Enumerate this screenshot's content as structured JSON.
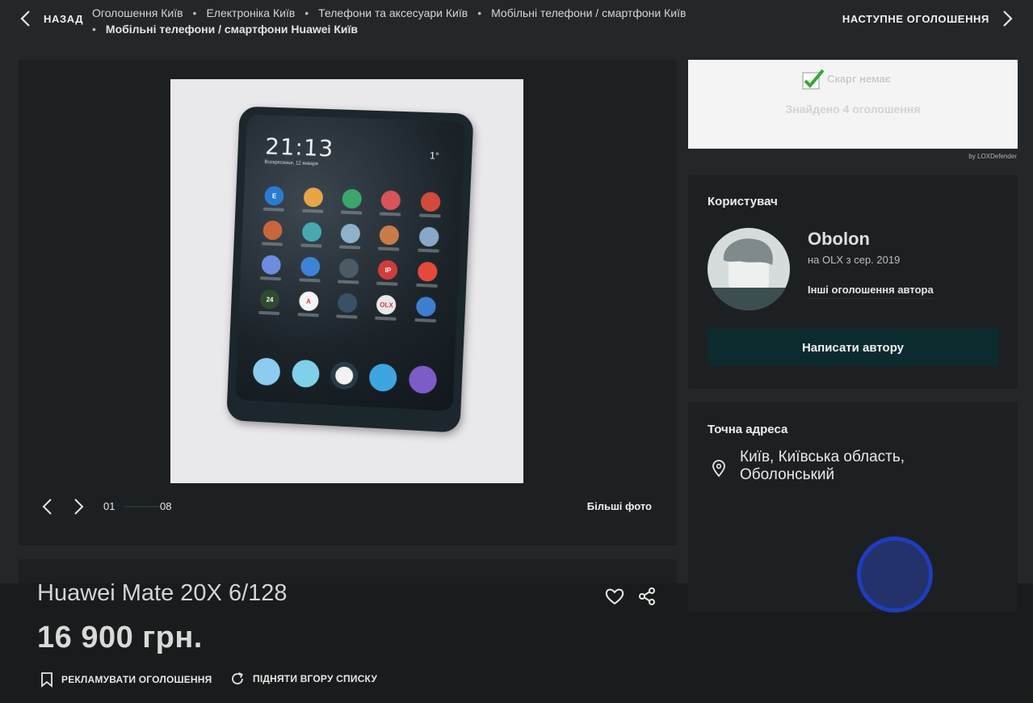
{
  "topbar": {
    "back_label": "НАЗАД",
    "next_label": "НАСТУПНЕ ОГОЛОШЕННЯ",
    "breadcrumbs": [
      "Оголошення Київ",
      "Електроніка Київ",
      "Телефони та аксесуари Київ",
      "Мобільні телефони / смартфони Київ",
      "Мобільні телефони / смартфони Huawei Київ"
    ]
  },
  "gallery": {
    "current_index": "01",
    "total": "08",
    "progress": 0.125,
    "more_photos_label": "Більші фото",
    "photo_text": {
      "clock": "21:13",
      "date": "Воскресенье, 12 января",
      "temp": "1°",
      "apps": [
        "E",
        "",
        "",
        "",
        "",
        "",
        "",
        "",
        "",
        "",
        "",
        "",
        "",
        "IP",
        "",
        "24",
        "А",
        "",
        "OLX",
        ""
      ]
    }
  },
  "listing": {
    "title": "Huawei Mate 20X 6/128",
    "price": "16 900 грн.",
    "promote_label": "РЕКЛАМУВАТИ ОГОЛОШЕННЯ",
    "raise_label": "ПІДНЯТИ ВГОРУ СПИСКУ"
  },
  "ad_widget": {
    "status": "Скарг немає",
    "found": "Знайдено 4 оголошення",
    "credit": "by LOXDefender"
  },
  "user": {
    "heading": "Користувач",
    "name": "Obolon",
    "since": "на OLX з сер. 2019",
    "other_ads": "Інші оголошення автора",
    "write_button": "Написати автору"
  },
  "address": {
    "heading": "Точна адреса",
    "text": "Київ, Київська область, Оболонський"
  },
  "colors": {
    "background": "#232729",
    "panel": "#1d2022",
    "button": "#0b2b2f",
    "fab_border": "#1f3cc0",
    "fab_fill": "#23326a"
  }
}
